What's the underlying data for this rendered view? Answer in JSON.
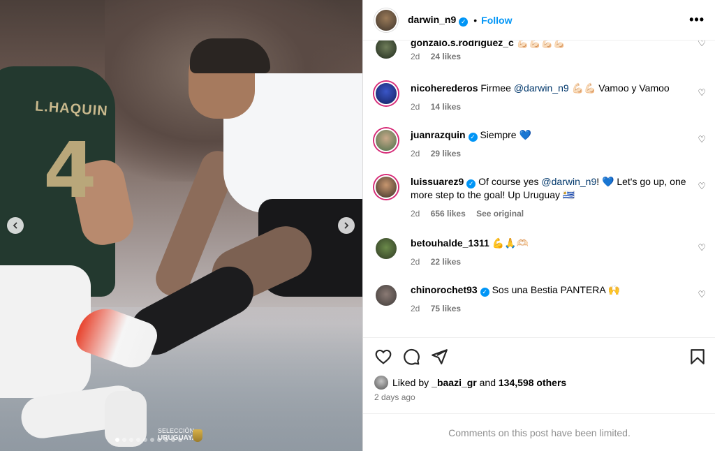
{
  "post": {
    "watermark_line1": "SELECCIÓN",
    "watermark_line2": "URUGUAYA",
    "carousel_dots": 10,
    "active_dot": 0
  },
  "header": {
    "username": "darwin_n9",
    "separator": "•",
    "follow_label": "Follow",
    "more_icon": "more-icon"
  },
  "comments": [
    {
      "username": "gonzalo.s.rodriguez_c",
      "text": "💪🏻💪🏻💪🏻💪🏻",
      "verified": false,
      "time": "2d",
      "likes": "24 likes",
      "extra": ""
    },
    {
      "username": "nicoherederos",
      "text_before": "Firmee ",
      "mention": "@darwin_n9",
      "text_after": " 💪🏻💪🏻 Vamoo y Vamoo",
      "verified": false,
      "time": "2d",
      "likes": "14 likes",
      "extra": ""
    },
    {
      "username": "juanrazquin",
      "text": "Siempre 💙",
      "verified": true,
      "time": "2d",
      "likes": "29 likes",
      "extra": ""
    },
    {
      "username": "luissuarez9",
      "text_before": "Of course yes ",
      "mention": "@darwin_n9",
      "text_after": "! 💙 Let's go up, one more step to the goal! Up Uruguay 🇺🇾",
      "verified": true,
      "time": "2d",
      "likes": "656 likes",
      "extra": "See original"
    },
    {
      "username": "betouhalde_1311",
      "text": "💪🙏🫶🏻",
      "verified": false,
      "time": "2d",
      "likes": "22 likes",
      "extra": ""
    },
    {
      "username": "chinorochet93",
      "text": "Sos una Bestia PANTERA 🙌",
      "verified": true,
      "time": "2d",
      "likes": "75 likes",
      "extra": ""
    }
  ],
  "actions": {
    "liked_by_prefix": "Liked by ",
    "liked_by_user": "_baazi_gr",
    "liked_by_middle": " and ",
    "liked_by_count": "134,598 others",
    "date": "2 days ago",
    "limited": "Comments on this post have been limited."
  }
}
